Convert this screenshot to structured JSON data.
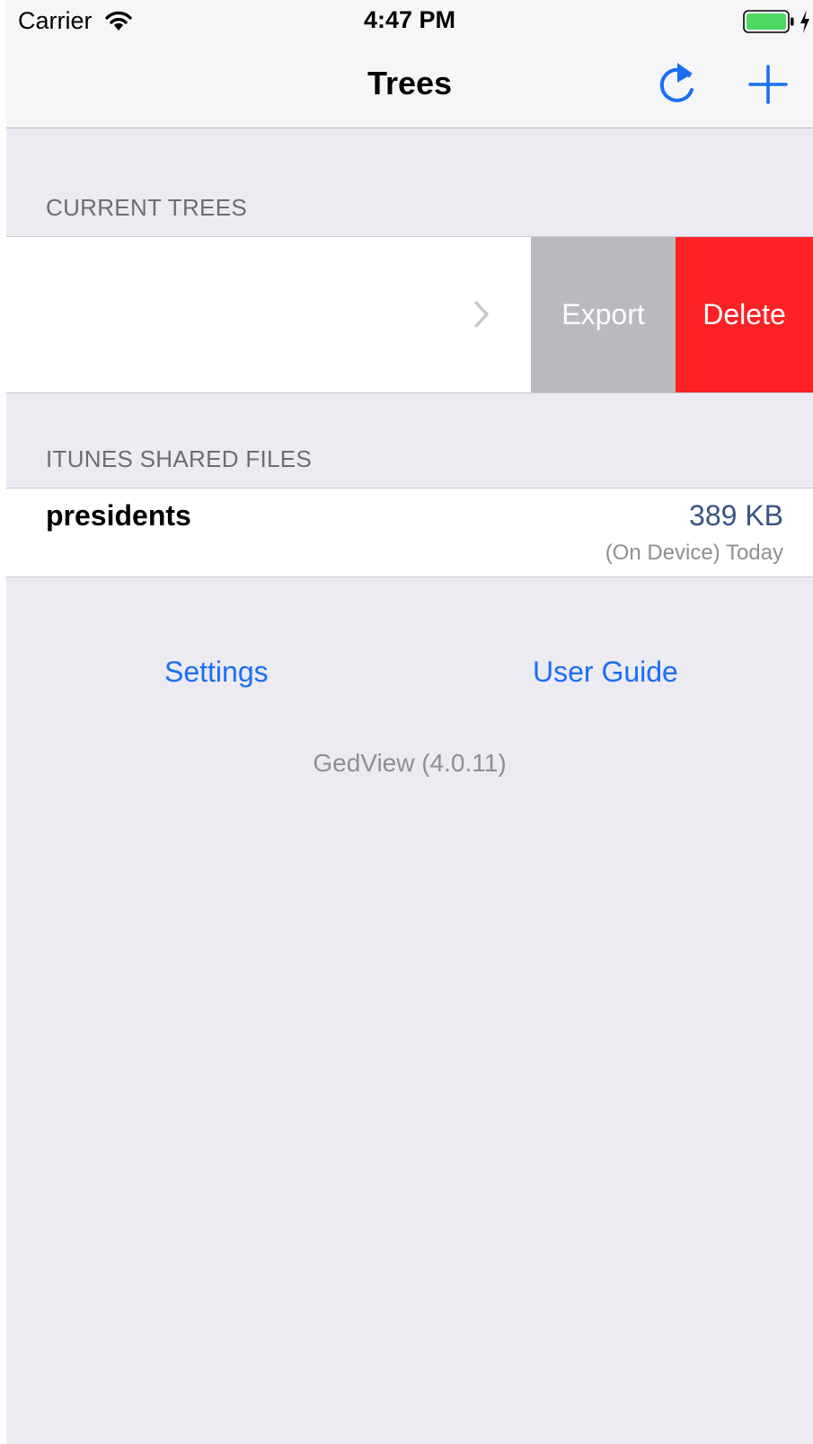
{
  "status_bar": {
    "carrier": "Carrier",
    "time": "4:47 PM",
    "battery_icon": "battery-full-icon",
    "wifi_icon": "wifi-icon",
    "charging_icon": "charging-bolt-icon",
    "battery_color": "#4cd964"
  },
  "nav": {
    "title": "Trees",
    "refresh_icon": "refresh-icon",
    "add_icon": "plus-icon",
    "accent_color": "#1a6ef5"
  },
  "current_trees": {
    "header": "CURRENT TREES",
    "row": {
      "chevron_icon": "chevron-right-icon",
      "actions": {
        "export_label": "Export",
        "delete_label": "Delete",
        "export_color": "#b9b9be",
        "delete_color": "#fc2125"
      }
    }
  },
  "shared_files": {
    "header": "ITUNES SHARED FILES",
    "items": [
      {
        "name": "presidents",
        "size": "389 KB",
        "meta": "(On Device) Today"
      }
    ]
  },
  "footer": {
    "settings_label": "Settings",
    "user_guide_label": "User Guide",
    "version": "GedView (4.0.11)"
  }
}
